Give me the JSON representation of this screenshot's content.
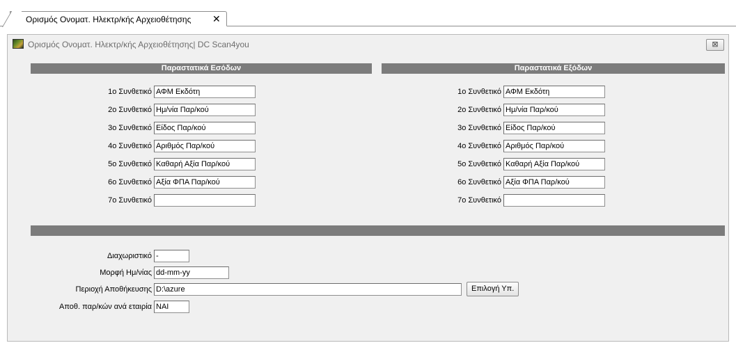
{
  "tab": {
    "label": "Ορισμός Ονοματ. Ηλεκτρ/κής Αρχειοθέτησης",
    "close_glyph": "✕"
  },
  "window": {
    "title": "Ορισμός Ονοματ. Ηλεκτρ/κής Αρχειοθέτησης| DC Scan4you",
    "close_glyph": "⊠"
  },
  "incoming": {
    "header": "Παραστατικά Εσόδων",
    "rows": [
      {
        "label": "1ο Συνθετικό",
        "value": "ΑΦΜ Εκδότη"
      },
      {
        "label": "2ο Συνθετικό",
        "value": "Ημ/νία Παρ/κού"
      },
      {
        "label": "3ο Συνθετικό",
        "value": "Είδος Παρ/κού"
      },
      {
        "label": "4ο Συνθετικό",
        "value": "Αριθμός Παρ/κού"
      },
      {
        "label": "5ο Συνθετικό",
        "value": "Καθαρή Αξία Παρ/κού"
      },
      {
        "label": "6ο Συνθετικό",
        "value": "Αξία ΦΠΑ Παρ/κού"
      },
      {
        "label": "7ο Συνθετικό",
        "value": ""
      }
    ]
  },
  "outgoing": {
    "header": "Παραστατικά Εξόδων",
    "rows": [
      {
        "label": "1ο Συνθετικό",
        "value": "ΑΦΜ Εκδότη"
      },
      {
        "label": "2ο Συνθετικό",
        "value": "Ημ/νία Παρ/κού"
      },
      {
        "label": "3ο Συνθετικό",
        "value": "Είδος Παρ/κού"
      },
      {
        "label": "4ο Συνθετικό",
        "value": "Αριθμός Παρ/κού"
      },
      {
        "label": "5ο Συνθετικό",
        "value": "Καθαρή Αξία Παρ/κού"
      },
      {
        "label": "6ο Συνθετικό",
        "value": "Αξία ΦΠΑ Παρ/κού"
      },
      {
        "label": "7ο Συνθετικό",
        "value": ""
      }
    ]
  },
  "settings": {
    "separator": {
      "label": "Διαχωριστικό",
      "value": "-"
    },
    "date_format": {
      "label": "Μορφή Ημ/νίας",
      "value": "dd-mm-yy"
    },
    "storage_path": {
      "label": "Περιοχή Αποθήκευσης",
      "value": "D:\\azure"
    },
    "browse_button": "Επιλογή Υπ.",
    "per_company": {
      "label": "Αποθ. παρ/κών ανά εταιρία",
      "value": "ΝΑΙ"
    }
  },
  "icons": {
    "app": "dc-scan4you-app-icon",
    "tab_close": "close-icon",
    "window_close": "close-box-icon"
  }
}
